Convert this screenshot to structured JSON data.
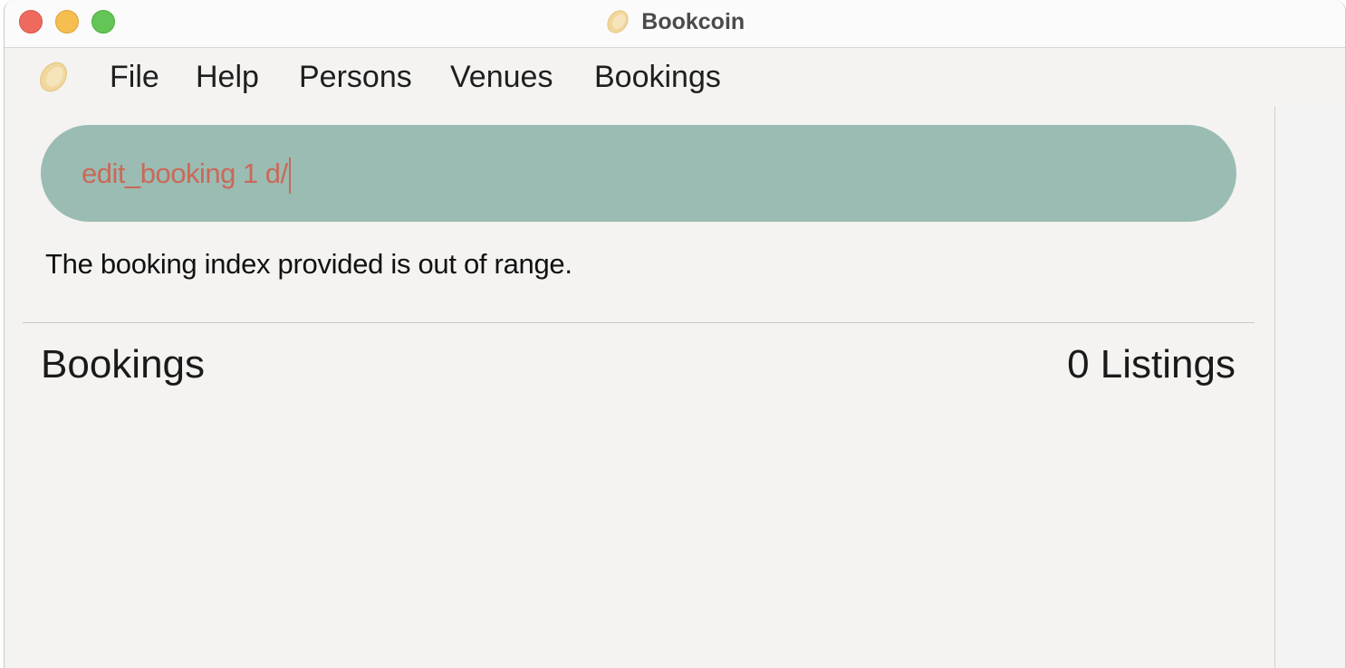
{
  "window": {
    "title": "Bookcoin",
    "app_icon": "coin-icon"
  },
  "menu": {
    "items": [
      {
        "label": "File"
      },
      {
        "label": "Help"
      },
      {
        "label": "Persons"
      },
      {
        "label": "Venues"
      },
      {
        "label": "Bookings"
      }
    ]
  },
  "command": {
    "value": "edit_booking 1 d/"
  },
  "result": {
    "message": "The booking index provided is out of range."
  },
  "list": {
    "title": "Bookings",
    "count_label": "0 Listings"
  },
  "colors": {
    "command_bg": "#9bbcb2",
    "command_text": "#c9695a",
    "window_bg": "#f4f3f1"
  }
}
